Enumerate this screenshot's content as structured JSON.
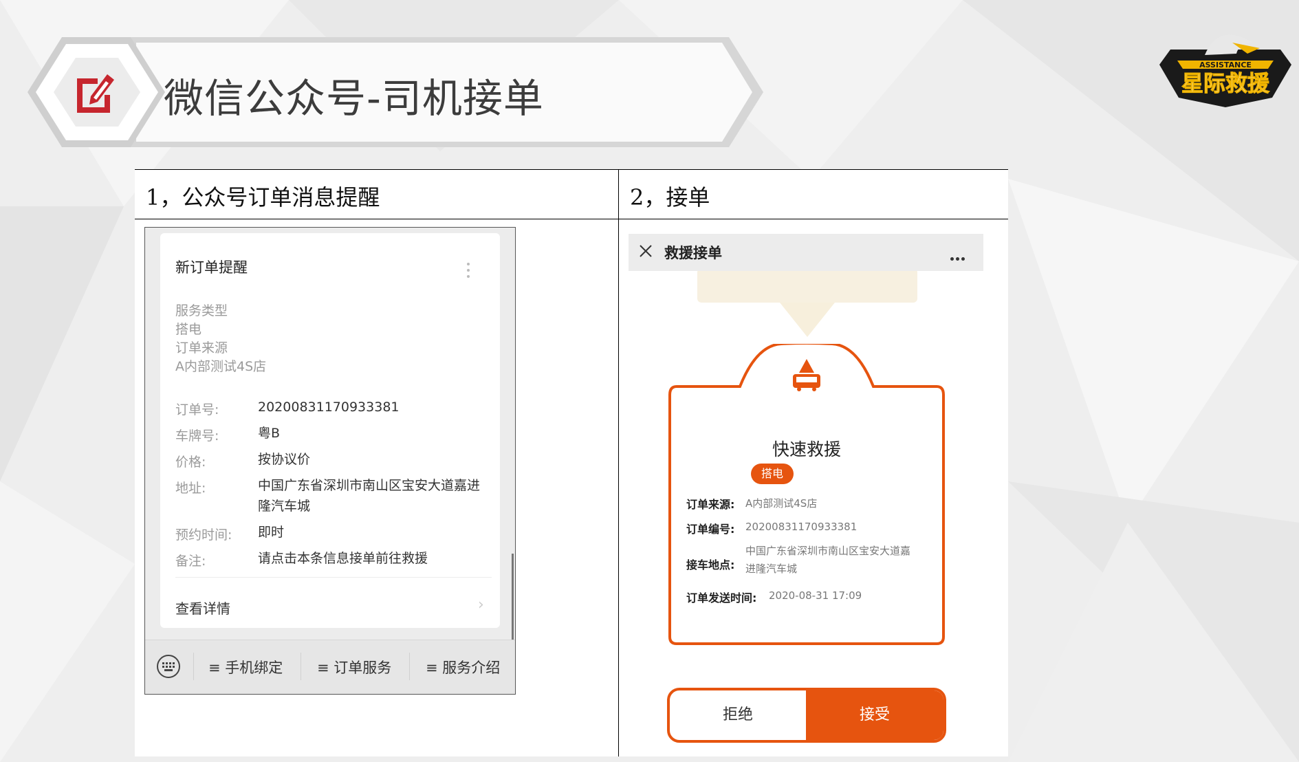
{
  "slide": {
    "title": "微信公众号-司机接单",
    "logo_text_top": "ASSISTANCE",
    "logo_text_main": "星际救援",
    "icon": "edit-icon"
  },
  "table": {
    "col1_header": "1，公众号订单消息提醒",
    "col2_header": "2，接单"
  },
  "left_phone": {
    "card_title": "新订单提醒",
    "gray_lines": [
      "服务类型",
      "搭电",
      "订单来源",
      "A内部测试4S店"
    ],
    "fields": [
      {
        "label": "订单号:",
        "value": "20200831170933381"
      },
      {
        "label": "车牌号:",
        "value": "粤B"
      },
      {
        "label": "价格:",
        "value": "按协议价"
      },
      {
        "label": "地址:",
        "value": "中国广东省深圳市南山区宝安大道嘉进隆汽车城"
      },
      {
        "label": "预约时间:",
        "value": "即时"
      },
      {
        "label": "备注:",
        "value": "请点击本条信息接单前往救援"
      }
    ],
    "detail_link": "查看详情",
    "menu": [
      "≡ 手机绑定",
      "≡ 订单服务",
      "≡ 服务介绍"
    ]
  },
  "right_phone": {
    "nav_title": "救援接单",
    "card_title": "快速救援",
    "badge": "搭电",
    "fields": [
      {
        "label": "订单来源:",
        "value": "A内部测试4S店"
      },
      {
        "label": "订单编号:",
        "value": "20200831170933381"
      },
      {
        "label": "接车地点:",
        "value": "中国广东省深圳市南山区宝安大道嘉进隆汽车城"
      },
      {
        "label": "订单发送时间:",
        "value": "2020-08-31 17:09"
      }
    ],
    "reject_label": "拒绝",
    "accept_label": "接受"
  },
  "colors": {
    "accent": "#e6540f",
    "banner_icon": "#c6262e"
  }
}
